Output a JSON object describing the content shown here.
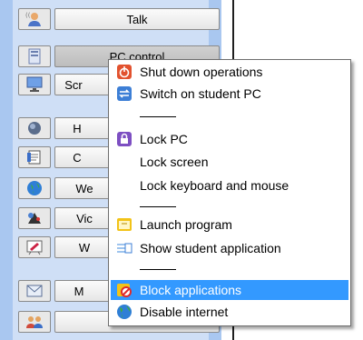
{
  "toolbar": {
    "rows": [
      {
        "label": "Talk",
        "icon": "talk-icon"
      },
      {
        "label": "PC control",
        "icon": "pc-control-icon"
      },
      {
        "label": "Scr",
        "icon": "screen-icon"
      },
      {
        "label": "H",
        "icon": "help-icon"
      },
      {
        "label": "C",
        "icon": "clipboard-icon"
      },
      {
        "label": "We",
        "icon": "web-icon"
      },
      {
        "label": "Vic",
        "icon": "video-icon"
      },
      {
        "label": "W",
        "icon": "whiteboard-icon"
      },
      {
        "label": "M",
        "icon": "message-icon"
      },
      {
        "label": "",
        "icon": "users-icon"
      }
    ]
  },
  "menu": {
    "items": [
      {
        "label": "Shut down operations",
        "icon": "power-icon"
      },
      {
        "label": "Switch on student PC",
        "icon": "switch-icon"
      },
      {
        "label": "Lock PC",
        "icon": "lock-icon"
      },
      {
        "label": "Lock screen",
        "icon": ""
      },
      {
        "label": "Lock keyboard and mouse",
        "icon": ""
      },
      {
        "label": "Launch program",
        "icon": "launch-icon"
      },
      {
        "label": "Show student application",
        "icon": "application-icon"
      },
      {
        "label": "Block applications",
        "icon": "block-icon",
        "highlighted": true
      },
      {
        "label": "Disable internet",
        "icon": "globe-icon"
      }
    ]
  },
  "colors": {
    "panel": "#a9c7f0",
    "highlight": "#3399ff"
  }
}
